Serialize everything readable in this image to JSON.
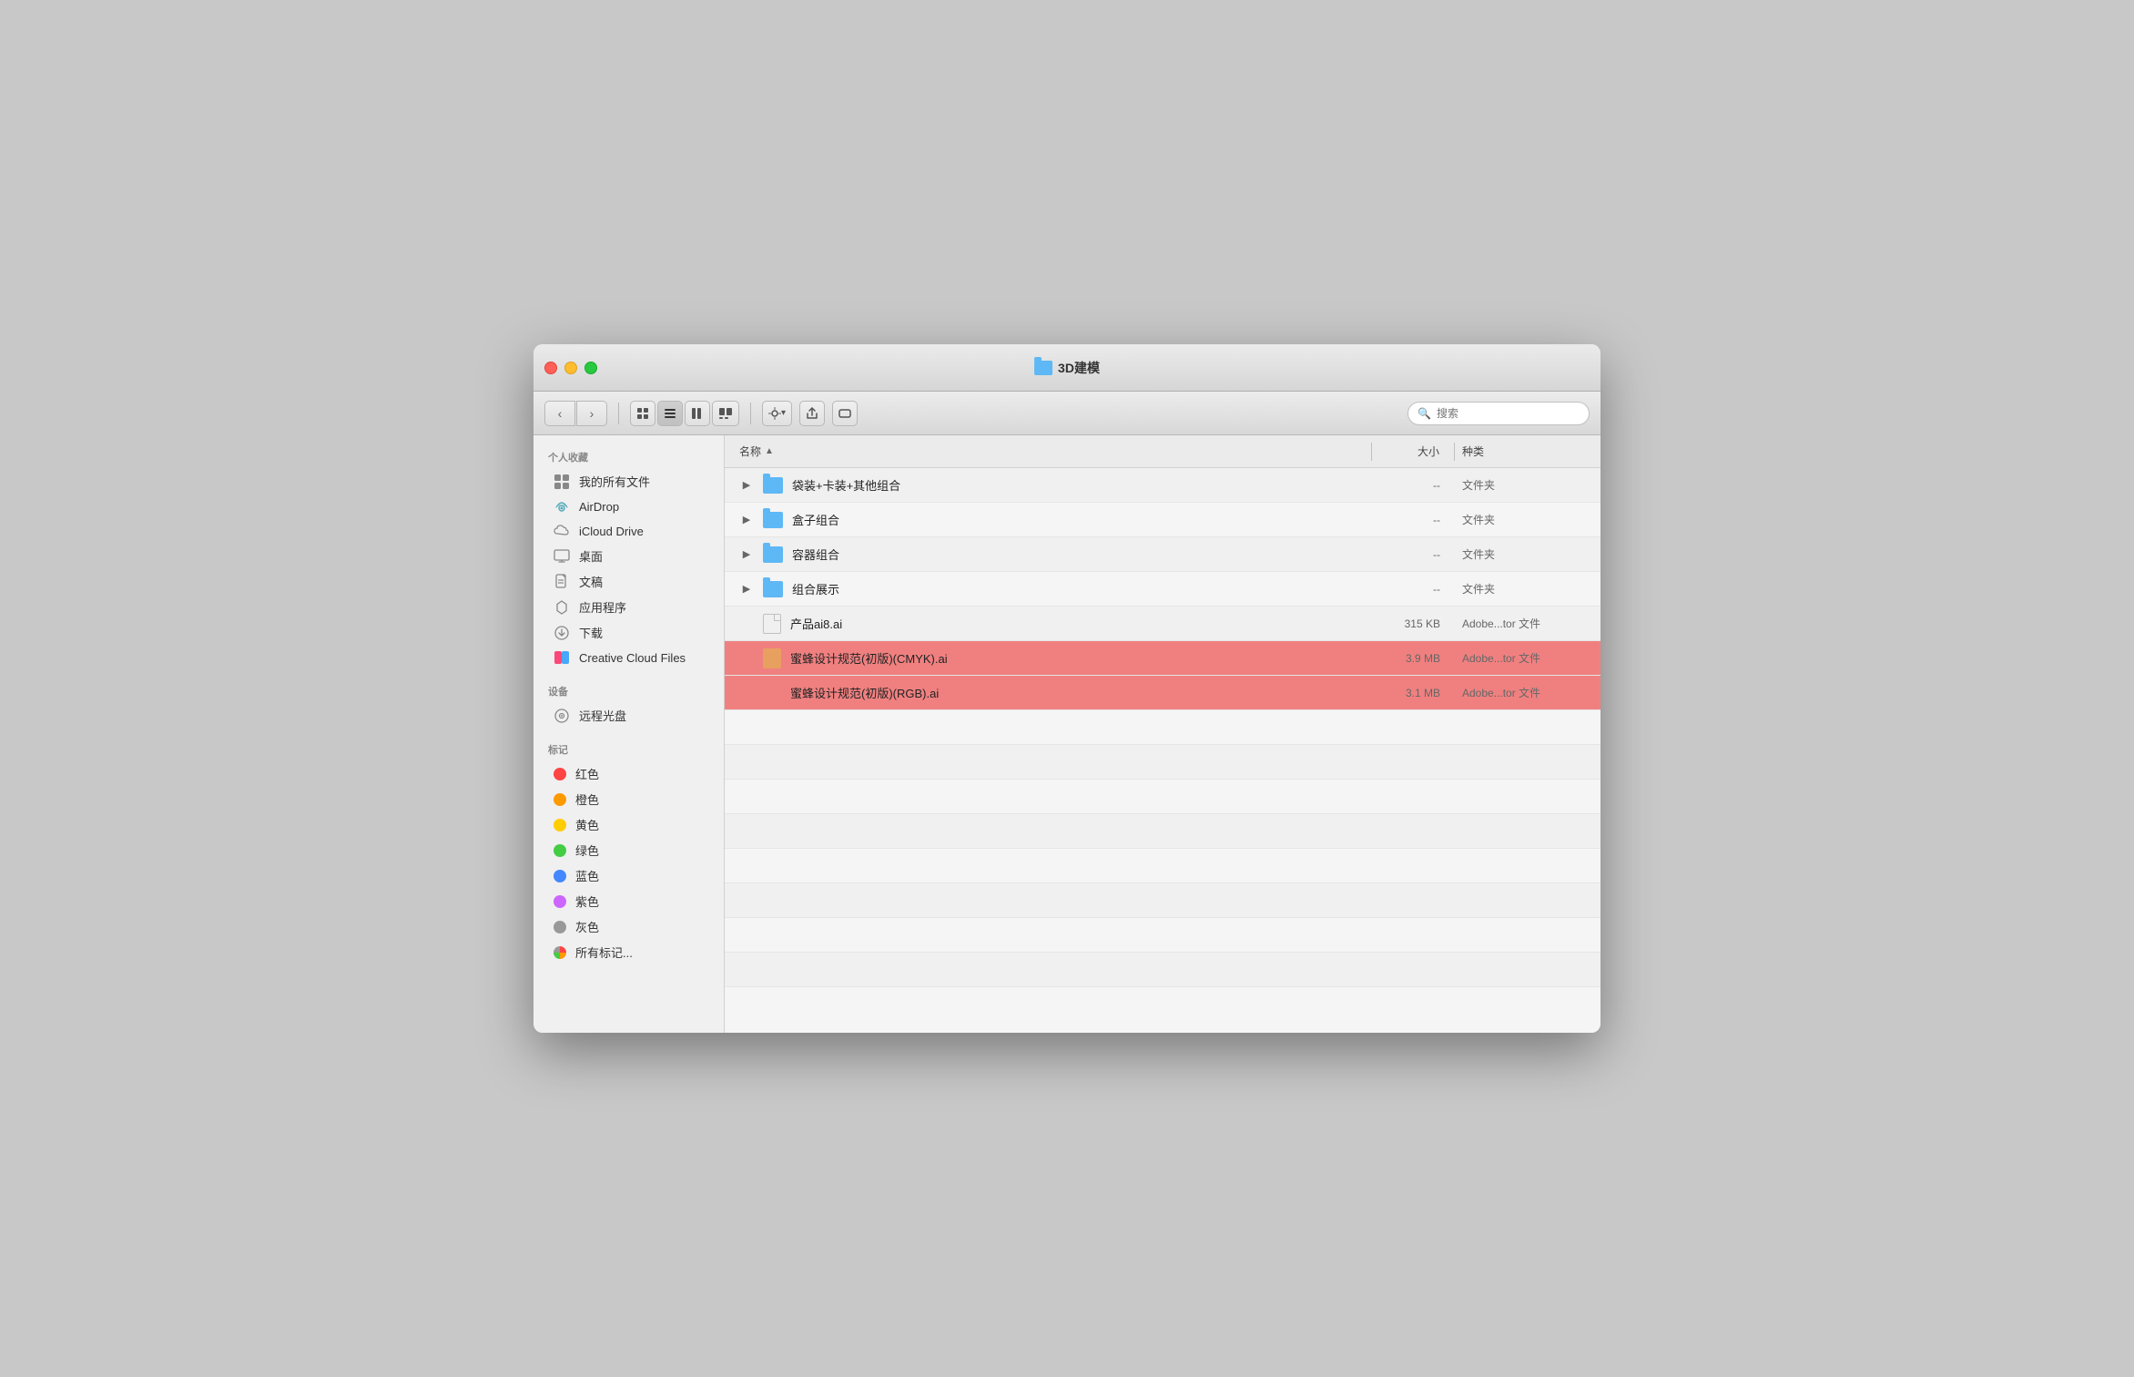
{
  "window": {
    "title": "3D建模",
    "folder_icon_color": "#5db8f5"
  },
  "toolbar": {
    "back_label": "‹",
    "forward_label": "›",
    "view_icons_label": "⊞",
    "view_list_label": "☰",
    "view_columns_label": "⊟",
    "view_cover_label": "⊡",
    "action_label": "⚙ ▾",
    "share_label": "⬆",
    "path_label": "⬜",
    "search_placeholder": "搜索"
  },
  "sidebar": {
    "section_personal": "个人收藏",
    "section_devices": "设备",
    "section_tags": "标记",
    "items_personal": [
      {
        "id": "all-files",
        "label": "我的所有文件",
        "icon": "grid-icon"
      },
      {
        "id": "airdrop",
        "label": "AirDrop",
        "icon": "airdrop-icon"
      },
      {
        "id": "icloud",
        "label": "iCloud Drive",
        "icon": "icloud-icon"
      },
      {
        "id": "desktop",
        "label": "桌面",
        "icon": "desktop-icon"
      },
      {
        "id": "documents",
        "label": "文稿",
        "icon": "document-icon"
      },
      {
        "id": "applications",
        "label": "应用程序",
        "icon": "app-icon"
      },
      {
        "id": "downloads",
        "label": "下载",
        "icon": "download-icon"
      },
      {
        "id": "creative-cloud",
        "label": "Creative Cloud Files",
        "icon": "cc-icon"
      }
    ],
    "items_devices": [
      {
        "id": "optical",
        "label": "远程光盘",
        "icon": "disc-icon"
      }
    ],
    "items_tags": [
      {
        "id": "red",
        "label": "红色",
        "color": "#f44"
      },
      {
        "id": "orange",
        "label": "橙色",
        "color": "#f90"
      },
      {
        "id": "yellow",
        "label": "黄色",
        "color": "#fc0"
      },
      {
        "id": "green",
        "label": "绿色",
        "color": "#4c4"
      },
      {
        "id": "blue",
        "label": "蓝色",
        "color": "#48f"
      },
      {
        "id": "purple",
        "label": "紫色",
        "color": "#c6f"
      },
      {
        "id": "gray",
        "label": "灰色",
        "color": "#999"
      },
      {
        "id": "all-tags",
        "label": "所有标记...",
        "color": null
      }
    ]
  },
  "file_list": {
    "col_name": "名称",
    "col_size": "大小",
    "col_type": "种类",
    "rows": [
      {
        "id": "row1",
        "name": "袋装+卡装+其他组合",
        "size": "--",
        "type": "文件夹",
        "is_folder": true,
        "selected": false
      },
      {
        "id": "row2",
        "name": "盒子组合",
        "size": "--",
        "type": "文件夹",
        "is_folder": true,
        "selected": false
      },
      {
        "id": "row3",
        "name": "容器组合",
        "size": "--",
        "type": "文件夹",
        "is_folder": true,
        "selected": false
      },
      {
        "id": "row4",
        "name": "组合展示",
        "size": "--",
        "type": "文件夹",
        "is_folder": true,
        "selected": false
      },
      {
        "id": "row5",
        "name": "产品ai8.ai",
        "size": "315 KB",
        "type": "Adobe...tor 文件",
        "is_folder": false,
        "selected": false,
        "ai_color": null
      },
      {
        "id": "row6",
        "name": "蜜蜂设计规范(初版)(CMYK).ai",
        "size": "3.9 MB",
        "type": "Adobe...tor 文件",
        "is_folder": false,
        "selected": true,
        "ai_color": "orange"
      },
      {
        "id": "row7",
        "name": "蜜蜂设计规范(初版)(RGB).ai",
        "size": "3.1 MB",
        "type": "Adobe...tor 文件",
        "is_folder": false,
        "selected": true,
        "ai_color": "pink"
      }
    ]
  }
}
